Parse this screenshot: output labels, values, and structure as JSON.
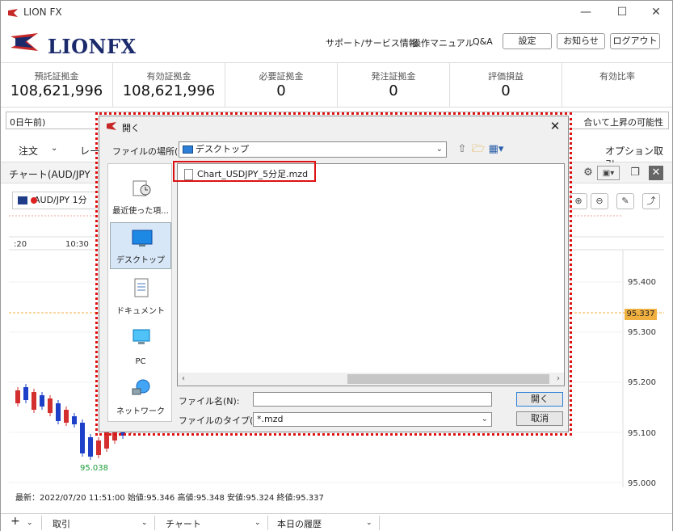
{
  "window": {
    "title": "LION FX",
    "min": "—",
    "max": "☐",
    "close": "✕"
  },
  "header": {
    "logo_text": "LIONFX",
    "links": [
      "サポート/サービス情報",
      "操作マニュアル",
      "Q&A"
    ],
    "buttons": [
      "設定",
      "お知らせ",
      "ログアウト"
    ]
  },
  "summary": [
    {
      "label": "預託証拠金",
      "value": "108,621,996"
    },
    {
      "label": "有効証拠金",
      "value": "108,621,996"
    },
    {
      "label": "必要証拠金",
      "value": "0"
    },
    {
      "label": "発注証拠金",
      "value": "0"
    },
    {
      "label": "評価損益",
      "value": "0"
    },
    {
      "label": "有効比率",
      "value": ""
    }
  ],
  "news": {
    "left": "0日午前)",
    "right": "合いて上昇の可能性"
  },
  "menu": {
    "order": "注文",
    "rate": "レー",
    "option": "オプション取引"
  },
  "chart_panel": {
    "title": "チャート(AUD/JPY"
  },
  "chart": {
    "symbol": "AUD/JPY 1分",
    "times": [
      ":20",
      "10:30"
    ],
    "price_ticks": [
      "95.400",
      "95.300",
      "95.200",
      "95.100",
      "95.000"
    ],
    "current_price": "95.337",
    "low_label": "95.038",
    "ohlc": "最新：2022/07/20 11:51:00 始値:95.346 高値:95.348 安値:95.324 終値:95.337"
  },
  "bottom_tabs": {
    "add": "+",
    "tab1": "取引",
    "tab2": "チャート",
    "tab3": "本日の履歴"
  },
  "dialog": {
    "title": "開く",
    "location_label": "ファイルの場所(I):",
    "location_value": "デスクトップ",
    "places": [
      "最近使った項...",
      "デスクトップ",
      "ドキュメント",
      "PC",
      "ネットワーク"
    ],
    "files": [
      "Chart_USDJPY_5分足.mzd"
    ],
    "filename_label": "ファイル名(N):",
    "filename_value": "",
    "filetype_label": "ファイルのタイプ(T):",
    "filetype_value": "*.mzd",
    "open_button": "開く",
    "cancel_button": "取消"
  }
}
